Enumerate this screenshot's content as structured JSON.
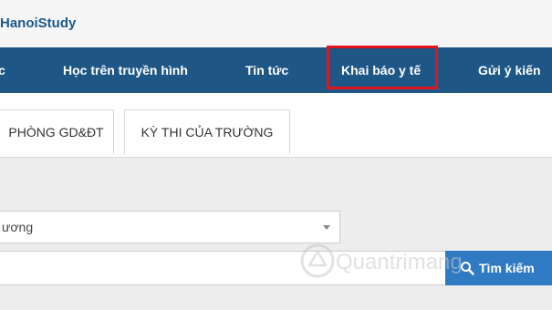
{
  "header": {
    "logo": "HanoiStudy"
  },
  "nav": {
    "items": [
      {
        "label": "c"
      },
      {
        "label": "Học trên truyền hình"
      },
      {
        "label": "Tin tức"
      },
      {
        "label": "Khai báo y tế"
      },
      {
        "label": "Gửi ý kiến"
      }
    ],
    "highlight_color": "#e3141b",
    "background": "#1e5786"
  },
  "tabs": [
    {
      "label": "PHÒNG GD&ĐT"
    },
    {
      "label": "KỲ THI CỦA TRƯỜNG"
    }
  ],
  "filter": {
    "select_value": "ương"
  },
  "search": {
    "input_value": "",
    "button_label": "Tìm kiếm",
    "button_icon": "search-icon"
  },
  "watermark": {
    "text": "Quantrimang"
  }
}
